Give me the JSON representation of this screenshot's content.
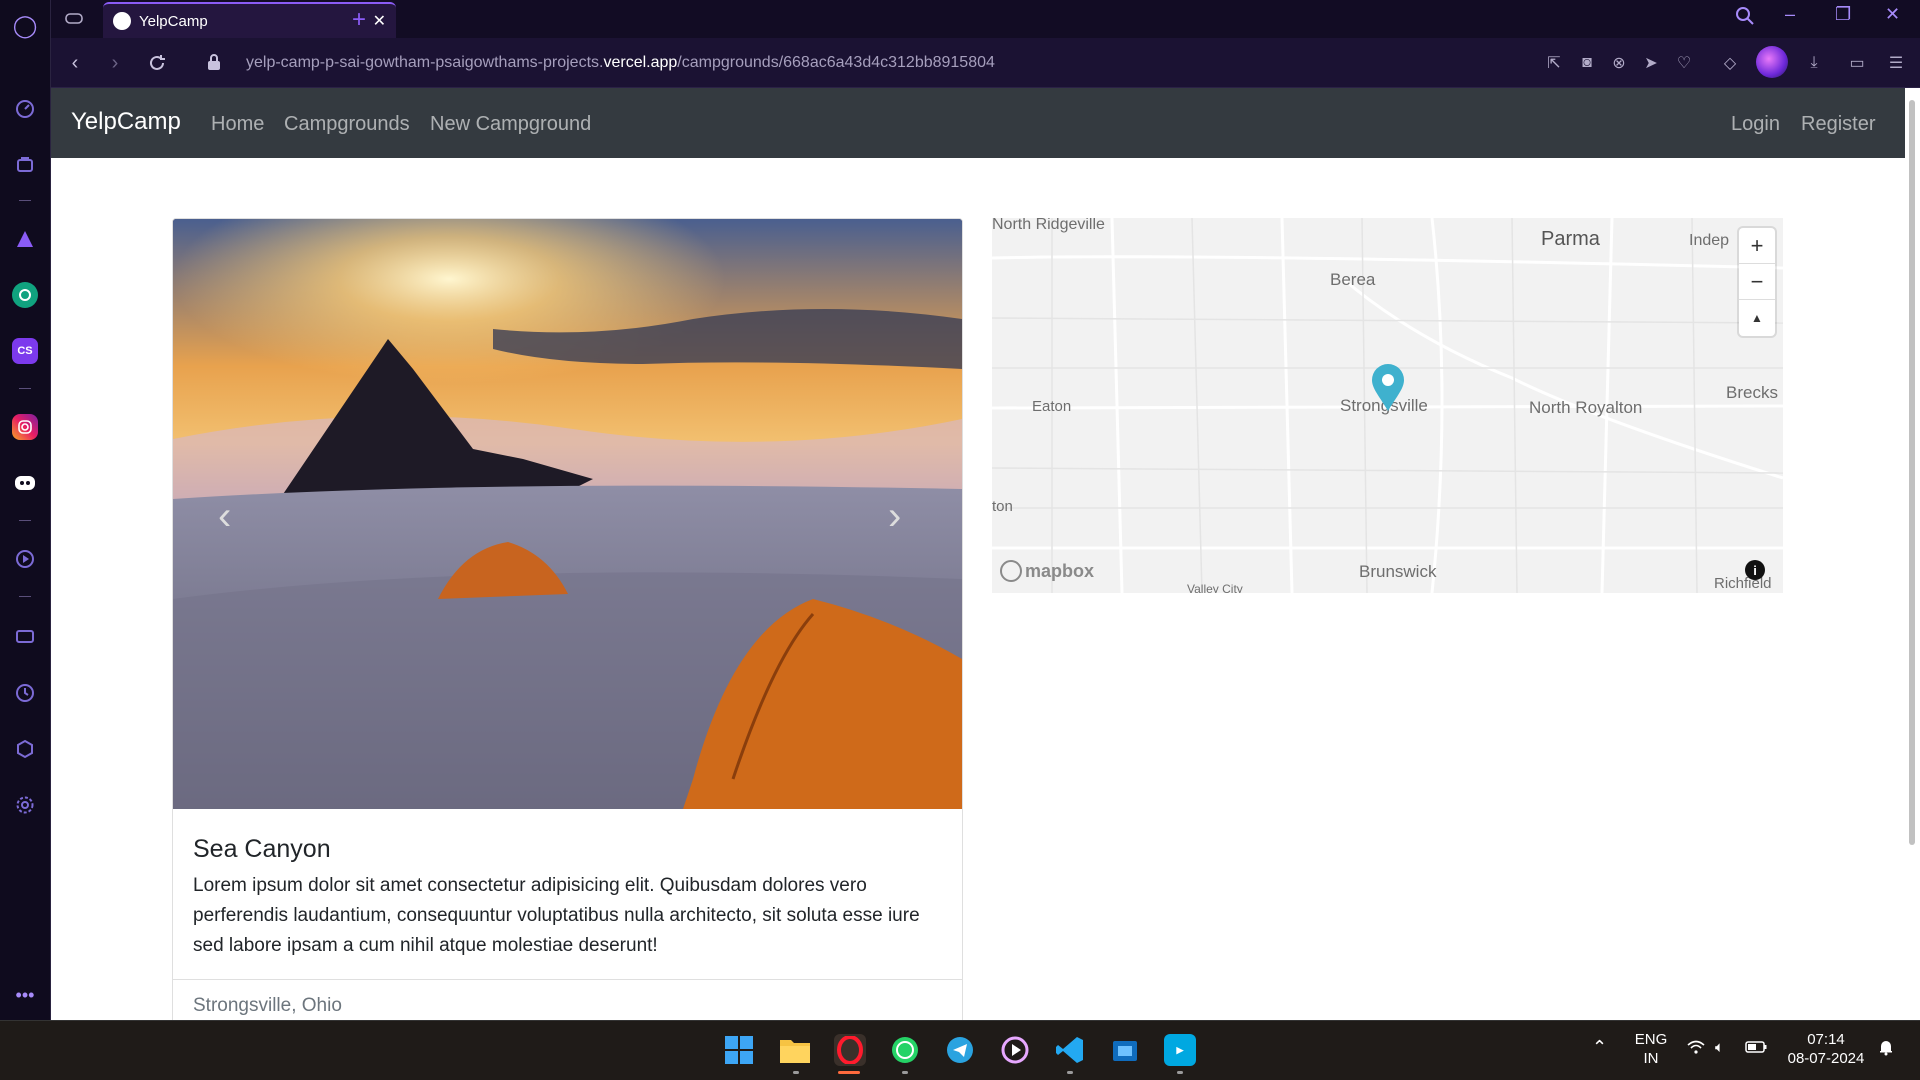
{
  "browser": {
    "tab_title": "YelpCamp",
    "url_prefix": "yelp-camp-p-sai-gowtham-psaigowthams-projects.",
    "url_domain": "vercel.app",
    "url_path": "/campgrounds/668ac6a43d4c312bb8915804",
    "window_controls": {
      "minimize": "–",
      "restore": "❐",
      "close": "✕"
    }
  },
  "navbar": {
    "brand": "YelpCamp",
    "links": [
      "Home",
      "Campgrounds",
      "New Campground"
    ],
    "right_links": [
      "Login",
      "Register"
    ]
  },
  "campground": {
    "title": "Sea Canyon",
    "description": "Lorem ipsum dolor sit amet consectetur adipisicing elit. Quibusdam dolores vero perferendis laudantium, consequuntur voluptatibus nulla architecto, sit soluta esse iure sed labore ipsam a cum nihil atque molestiae deserunt!",
    "location": "Strongsville, Ohio",
    "carousel_prev": "‹",
    "carousel_next": "›"
  },
  "map": {
    "labels": [
      "North Ridgeville",
      "Parma",
      "Indep",
      "Berea",
      "Eaton",
      "Strongsville",
      "North Royalton",
      "Brecks",
      "ton",
      "Brunswick",
      "Valley City",
      "Richfield"
    ],
    "attribution": "mapbox",
    "zoom_in": "+",
    "zoom_out": "−",
    "compass": "▲",
    "info": "i",
    "marker_color": "#3fb1ce"
  },
  "taskbar": {
    "lang_top": "ENG",
    "lang_bottom": "IN",
    "time": "07:14",
    "date": "08-07-2024"
  },
  "colors": {
    "navbar": "#343a40",
    "opera_accent": "#8b5cf6"
  }
}
